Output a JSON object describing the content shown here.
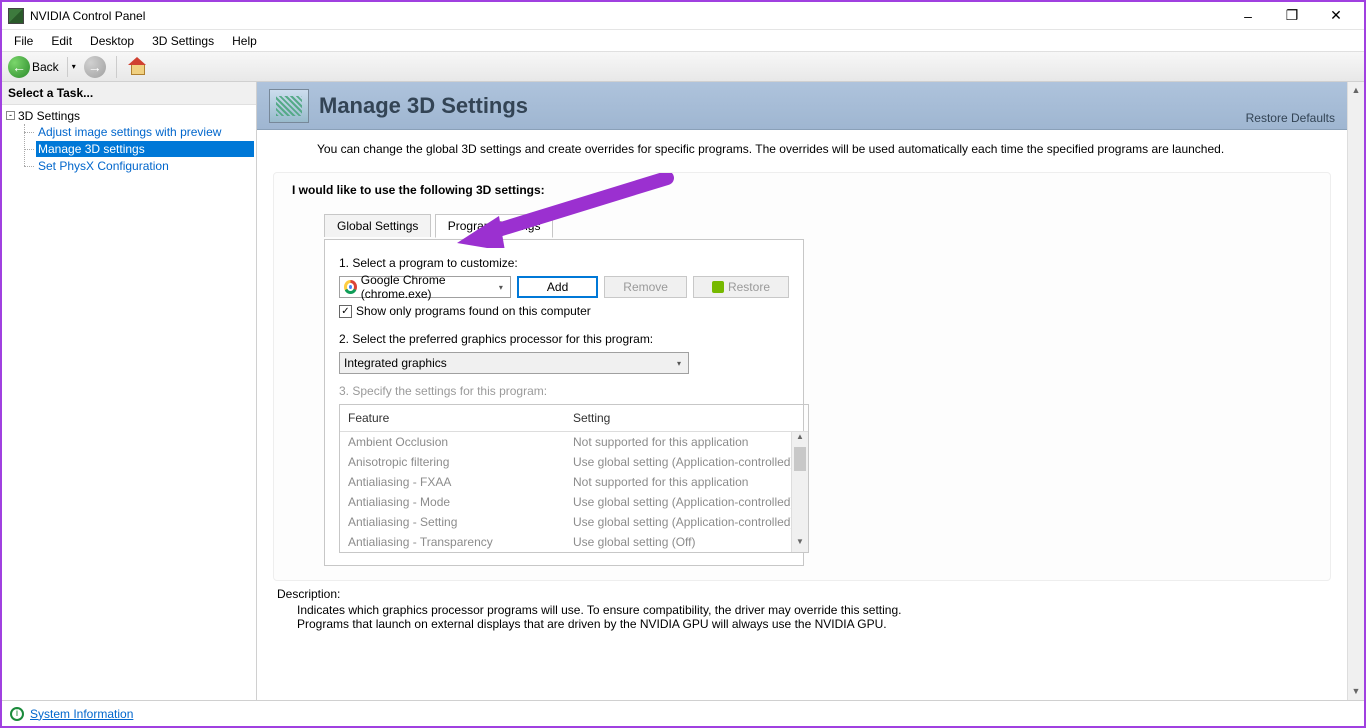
{
  "window": {
    "title": "NVIDIA Control Panel"
  },
  "menu": [
    "File",
    "Edit",
    "Desktop",
    "3D Settings",
    "Help"
  ],
  "toolbar": {
    "back_label": "Back"
  },
  "sidebar": {
    "select_task": "Select a Task...",
    "root": "3D Settings",
    "items": [
      "Adjust image settings with preview",
      "Manage 3D settings",
      "Set PhysX Configuration"
    ],
    "selected_index": 1
  },
  "header": {
    "title": "Manage 3D Settings",
    "restore": "Restore Defaults"
  },
  "intro": "You can change the global 3D settings and create overrides for specific programs. The overrides will be used automatically each time the specified programs are launched.",
  "card": {
    "title": "I would like to use the following 3D settings:",
    "tabs": {
      "global": "Global Settings",
      "program": "Program Settings"
    },
    "step1": {
      "label": "1. Select a program to customize:",
      "program_value": "Google Chrome (chrome.exe)",
      "add": "Add",
      "remove": "Remove",
      "restore": "Restore",
      "checkbox_label": "Show only programs found on this computer",
      "checkbox_checked": true
    },
    "step2": {
      "label": "2. Select the preferred graphics processor for this program:",
      "value": "Integrated graphics"
    },
    "step3": {
      "label": "3. Specify the settings for this program:",
      "columns": {
        "feature": "Feature",
        "setting": "Setting"
      },
      "rows": [
        {
          "feature": "Ambient Occlusion",
          "setting": "Not supported for this application"
        },
        {
          "feature": "Anisotropic filtering",
          "setting": "Use global setting (Application-controlled)"
        },
        {
          "feature": "Antialiasing - FXAA",
          "setting": "Not supported for this application"
        },
        {
          "feature": "Antialiasing - Mode",
          "setting": "Use global setting (Application-controlled)"
        },
        {
          "feature": "Antialiasing - Setting",
          "setting": "Use global setting (Application-controlled)"
        },
        {
          "feature": "Antialiasing - Transparency",
          "setting": "Use global setting (Off)"
        }
      ]
    }
  },
  "description": {
    "title": "Description:",
    "body_line1": "Indicates which graphics processor programs will use. To ensure compatibility, the driver may override this setting.",
    "body_line2": "Programs that launch on external displays that are driven by the NVIDIA GPU will always use the NVIDIA GPU."
  },
  "statusbar": {
    "sysinfo": "System Information"
  }
}
